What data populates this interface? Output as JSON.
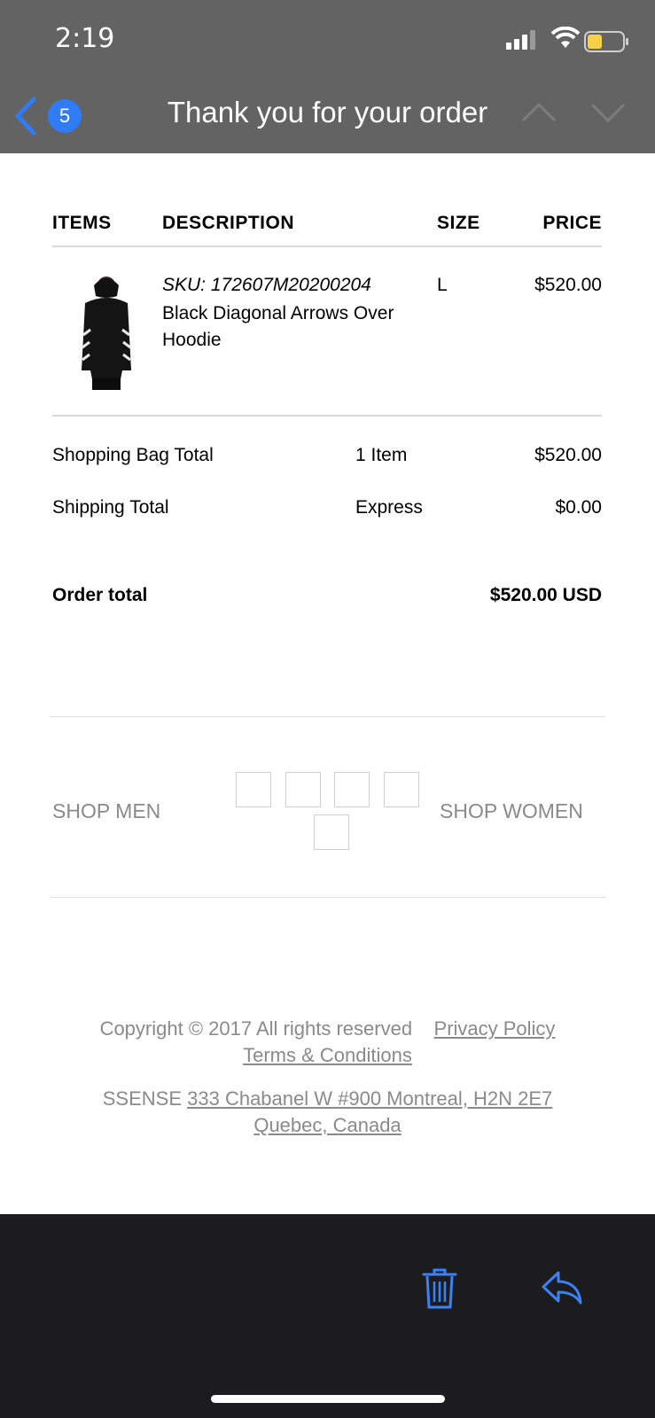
{
  "status_bar": {
    "time": "2:19"
  },
  "header": {
    "back_count": "5",
    "title": "Thank you for your order"
  },
  "table": {
    "headers": {
      "items": "ITEMS",
      "description": "DESCRIPTION",
      "size": "SIZE",
      "price": "PRICE"
    },
    "product": {
      "sku": "SKU: 172607M20200204",
      "name": "Black Diagonal Arrows Over Hoodie",
      "size": "L",
      "price": "$520.00"
    }
  },
  "totals": {
    "bag_label": "Shopping Bag Total",
    "bag_count": "1 Item",
    "bag_value": "$520.00",
    "shipping_label": "Shipping Total",
    "shipping_method": "Express",
    "shipping_value": "$0.00",
    "order_label": "Order total",
    "order_value": "$520.00 USD"
  },
  "shop": {
    "men": "SHOP MEN",
    "women": "SHOP WOMEN"
  },
  "footer": {
    "copyright": "Copyright © 2017 All rights reserved",
    "privacy": "Privacy Policy",
    "terms": "Terms & Conditions",
    "company": "SSENSE",
    "address_line1": "333 Chabanel W #900 Montreal, H2N 2E7",
    "address_line2": "Quebec, Canada"
  },
  "colors": {
    "header_bg": "#636363",
    "accent": "#2f7cf6",
    "toolbar_bg": "#1c1c1e",
    "footer_text": "#8a8a8a"
  },
  "icons": [
    "signal-icon",
    "wifi-icon",
    "battery-icon",
    "back-chevron-icon",
    "chevron-up-icon",
    "chevron-down-icon",
    "trash-icon",
    "reply-icon"
  ]
}
